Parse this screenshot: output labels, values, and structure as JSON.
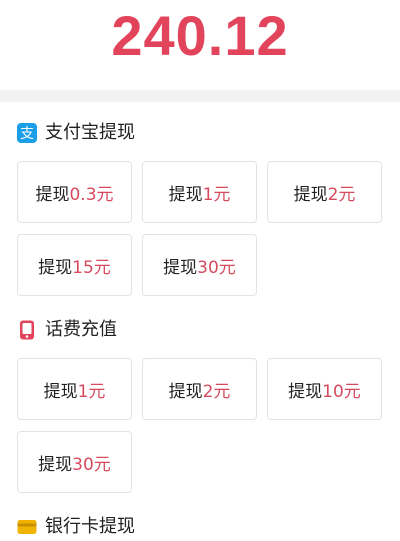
{
  "balance": {
    "amount": "240.12"
  },
  "sections": [
    {
      "title": "支付宝提现",
      "icon": "alipay-icon",
      "icon_color": "#1a9ee8",
      "options": [
        {
          "prefix": "提现",
          "amount": "0.3元"
        },
        {
          "prefix": "提现",
          "amount": "1元"
        },
        {
          "prefix": "提现",
          "amount": "2元"
        },
        {
          "prefix": "提现",
          "amount": "15元"
        },
        {
          "prefix": "提现",
          "amount": "30元"
        }
      ]
    },
    {
      "title": "话费充值",
      "icon": "phone-icon",
      "icon_color": "#e2445c",
      "options": [
        {
          "prefix": "提现",
          "amount": "1元"
        },
        {
          "prefix": "提现",
          "amount": "2元"
        },
        {
          "prefix": "提现",
          "amount": "10元"
        },
        {
          "prefix": "提现",
          "amount": "30元"
        }
      ]
    },
    {
      "title": "银行卡提现",
      "icon": "bank-card-icon",
      "icon_color": "#f0b400",
      "options": []
    }
  ],
  "colors": {
    "accent": "#e2445c",
    "amount_text": "#d64a5f",
    "divider": "#f2f2f2",
    "box_border": "#e3e3e3"
  }
}
